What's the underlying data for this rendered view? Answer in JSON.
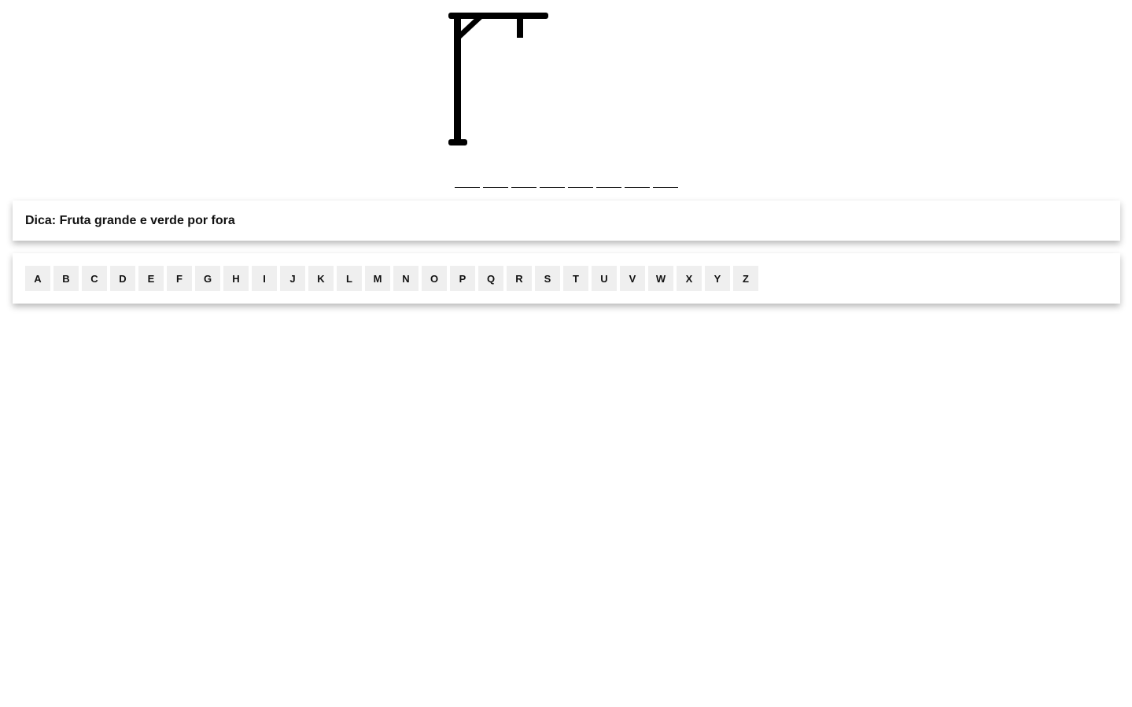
{
  "game": {
    "word_length": 8,
    "guessed_letters": [
      "",
      "",
      "",
      "",
      "",
      "",
      "",
      ""
    ],
    "hint_label": "Dica:",
    "hint_text": "Fruta grande e verde por fora",
    "errors": 0
  },
  "keyboard": {
    "letters": [
      "A",
      "B",
      "C",
      "D",
      "E",
      "F",
      "G",
      "H",
      "I",
      "J",
      "K",
      "L",
      "M",
      "N",
      "O",
      "P",
      "Q",
      "R",
      "S",
      "T",
      "U",
      "V",
      "W",
      "X",
      "Y",
      "Z"
    ]
  }
}
